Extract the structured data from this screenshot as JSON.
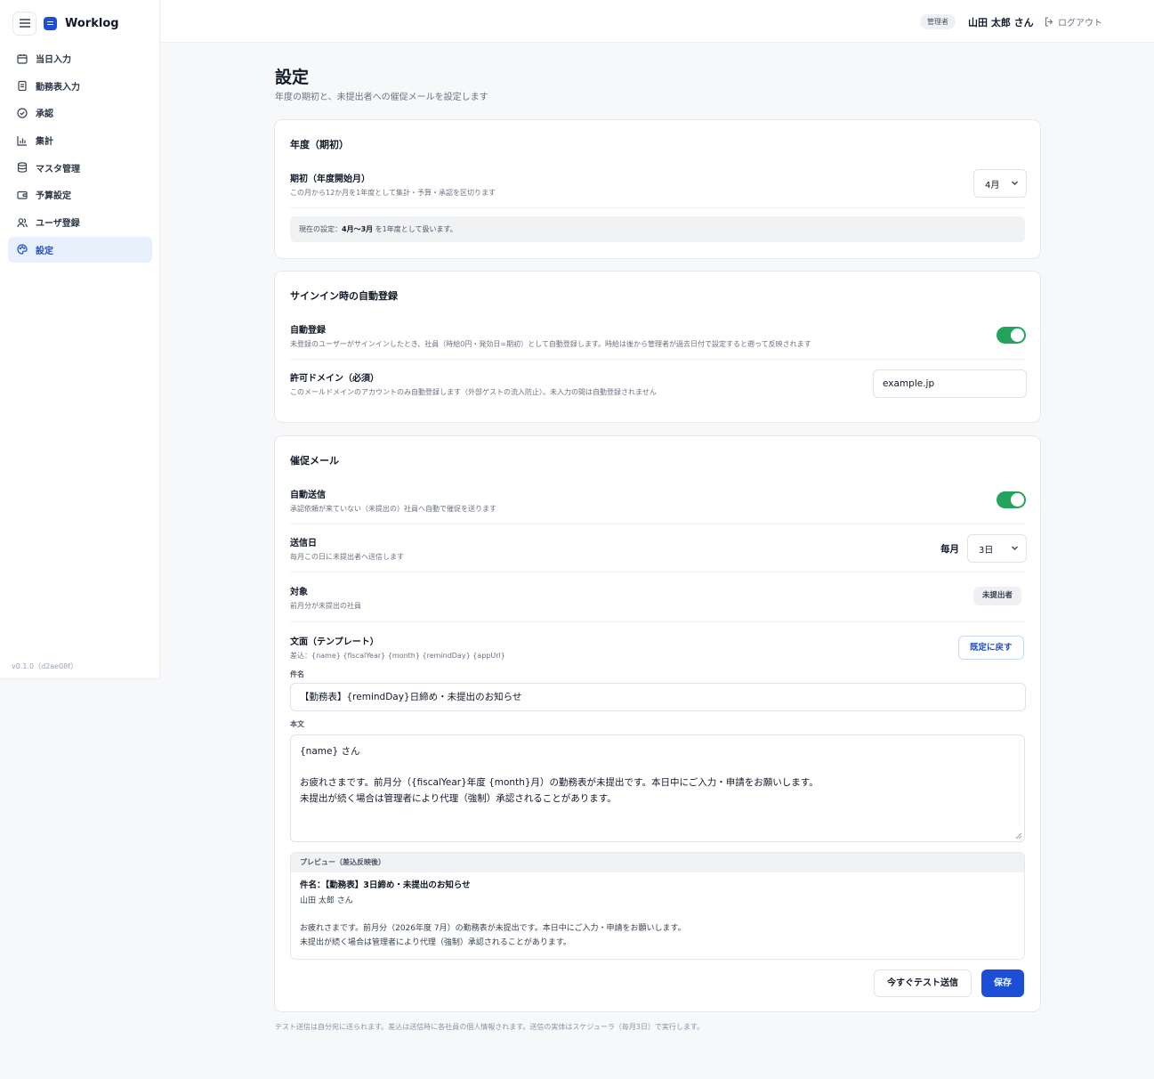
{
  "app": {
    "name": "Worklog",
    "version": "v0.1.0（d2ae08f）"
  },
  "header": {
    "role_badge": "管理者",
    "user_name": "山田 太郎 さん",
    "logout_label": "ログアウト"
  },
  "sidebar": {
    "items": [
      {
        "label": "当日入力",
        "icon": "calendar-icon"
      },
      {
        "label": "勤務表入力",
        "icon": "clipboard-icon"
      },
      {
        "label": "承認",
        "icon": "check-circle-icon"
      },
      {
        "label": "集計",
        "icon": "bar-chart-icon"
      },
      {
        "label": "マスタ管理",
        "icon": "database-icon"
      },
      {
        "label": "予算設定",
        "icon": "wallet-icon"
      },
      {
        "label": "ユーザ登録",
        "icon": "users-icon"
      },
      {
        "label": "設定",
        "icon": "palette-icon",
        "active": true
      }
    ]
  },
  "page": {
    "title": "設定",
    "subtitle": "年度の期初と、未提出者への催促メールを設定します"
  },
  "fiscal": {
    "title": "年度（期初）",
    "start_label": "期初（年度開始月）",
    "start_desc": "この月から12か月を1年度として集計・予算・承認を区切ります",
    "start_value": "4月",
    "info_prefix": "現在の設定：",
    "info_range": "4月〜3月",
    "info_suffix": " を1年度として扱います。"
  },
  "signin": {
    "title": "サインイン時の自動登録",
    "auto_label": "自動登録",
    "auto_desc": "未登録のユーザーがサインインしたとき、社員（時給0円・発効日=期初）として自動登録します。時給は後から管理者が過去日付で設定すると遡って反映されます",
    "auto_enabled": true,
    "domain_label": "許可ドメイン（必須）",
    "domain_desc": "このメールドメインのアカウントのみ自動登録します（外部ゲストの流入防止）。未入力の間は自動登録されません",
    "domain_value": "example.jp"
  },
  "reminder": {
    "title": "催促メール",
    "auto_label": "自動送信",
    "auto_desc": "承認依頼が来ていない（未提出の）社員へ自動で催促を送ります",
    "auto_enabled": true,
    "day_label": "送信日",
    "day_desc": "毎月この日に未提出者へ送信します",
    "day_prefix": "毎月",
    "day_value": "3日",
    "target_label": "対象",
    "target_desc": "前月分が未提出の社員",
    "target_value": "未提出者",
    "template_label": "文面（テンプレート）",
    "template_vars": "差込：{name} {fiscalYear} {month} {remindDay} {appUrl}",
    "reset_label": "既定に戻す",
    "subject_label": "件名",
    "subject_value": "【勤務表】{remindDay}日締め・未提出のお知らせ",
    "body_label": "本文",
    "body_lines": [
      "{name} さん",
      "",
      "お疲れさまです。前月分（{fiscalYear}年度 {month}月）の勤務表が未提出です。本日中にご入力・申請をお願いします。",
      "未提出が続く場合は管理者により代理（強制）承認されることがあります。"
    ],
    "preview_label": "プレビュー（差込反映後）",
    "preview_subject": "件名：【勤務表】3日締め・未提出のお知らせ",
    "preview_lines": [
      "山田 太郎 さん",
      "",
      "お疲れさまです。前月分（2026年度 7月）の勤務表が未提出です。本日中にご入力・申請をお願いします。",
      "未提出が続く場合は管理者により代理（強制）承認されることがあります。"
    ],
    "test_send_label": "今すぐテスト送信",
    "save_label": "保存"
  },
  "footnote": "テスト送信は自分宛に送られます。差込は送信時に各社員の個人情報されます。送信の実体はスケジューラ（毎月3日）で実行します。",
  "colors": {
    "accent": "#1d4ed8",
    "toggle_on": "#22a45d",
    "active_nav_bg": "#e8f0fb"
  }
}
